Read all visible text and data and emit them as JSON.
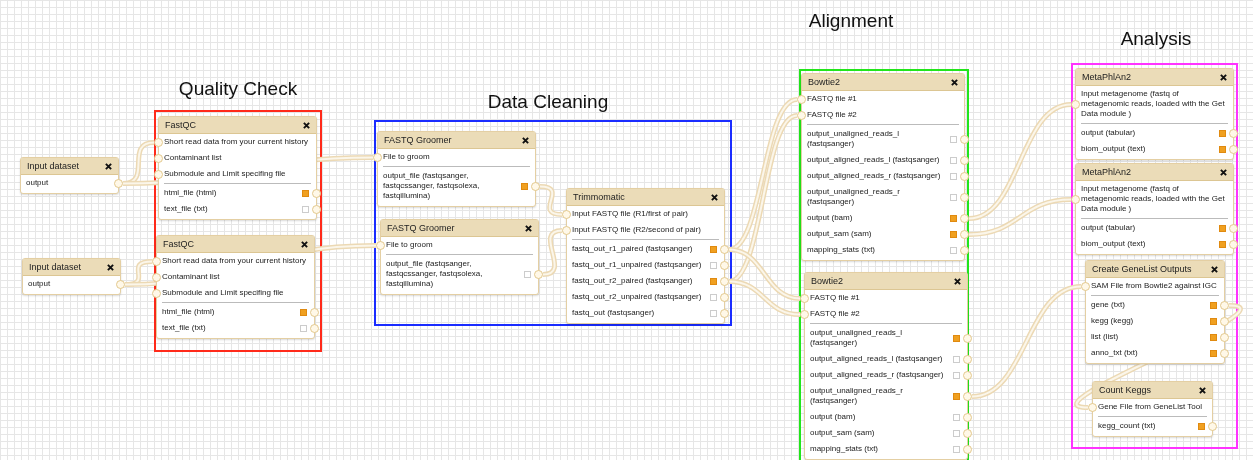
{
  "inputs": [
    {
      "title": "Input dataset",
      "outputs": [
        "output"
      ]
    },
    {
      "title": "Input dataset",
      "outputs": [
        "output"
      ]
    }
  ],
  "groups": [
    {
      "title": "Quality Check",
      "color": "#ff2a1a",
      "nodes": [
        {
          "title": "FastQC",
          "inputs": [
            "Short read data from your current history",
            "Contaminant list",
            "Submodule and Limit specifing file"
          ],
          "outputs": [
            {
              "label": "html_file (html)",
              "checked": true
            },
            {
              "label": "text_file (txt)",
              "checked": false
            }
          ]
        },
        {
          "title": "FastQC",
          "inputs": [
            "Short read data from your current history",
            "Contaminant list",
            "Submodule and Limit specifing file"
          ],
          "outputs": [
            {
              "label": "html_file (html)",
              "checked": true
            },
            {
              "label": "text_file (txt)",
              "checked": false
            }
          ]
        }
      ]
    },
    {
      "title": "Data Cleaning",
      "color": "#1a2cff",
      "nodes": [
        {
          "title": "FASTQ Groomer",
          "inputs": [
            "File to groom"
          ],
          "outputs": [
            {
              "label": "output_file (fastqsanger, fastqcssanger, fastqsolexa, fastqillumina)",
              "checked": true
            }
          ]
        },
        {
          "title": "FASTQ Groomer",
          "inputs": [
            "File to groom"
          ],
          "outputs": [
            {
              "label": "output_file (fastqsanger, fastqcssanger, fastqsolexa, fastqillumina)",
              "checked": false
            }
          ]
        },
        {
          "title": "Trimmomatic",
          "inputs": [
            "Input FASTQ file (R1/first of pair)",
            "Input FASTQ file (R2/second of pair)"
          ],
          "outputs": [
            {
              "label": "fastq_out_r1_paired (fastqsanger)",
              "checked": true
            },
            {
              "label": "fastq_out_r1_unpaired (fastqsanger)",
              "checked": false
            },
            {
              "label": "fastq_out_r2_paired (fastqsanger)",
              "checked": true
            },
            {
              "label": "fastq_out_r2_unpaired (fastqsanger)",
              "checked": false
            },
            {
              "label": "fastq_out (fastqsanger)",
              "checked": false
            }
          ]
        }
      ]
    },
    {
      "title": "Alignment",
      "color": "#22e51a",
      "nodes": [
        {
          "title": "Bowtie2",
          "inputs": [
            "FASTQ file #1",
            "FASTQ file #2"
          ],
          "outputs": [
            {
              "label": "output_unaligned_reads_l (fastqsanger)",
              "checked": false
            },
            {
              "label": "output_aligned_reads_l (fastqsanger)",
              "checked": false
            },
            {
              "label": "output_aligned_reads_r (fastqsanger)",
              "checked": false
            },
            {
              "label": "output_unaligned_reads_r (fastqsanger)",
              "checked": false
            },
            {
              "label": "output (bam)",
              "checked": true
            },
            {
              "label": "output_sam (sam)",
              "checked": true
            },
            {
              "label": "mapping_stats (txt)",
              "checked": false
            }
          ]
        },
        {
          "title": "Bowtie2",
          "inputs": [
            "FASTQ file #1",
            "FASTQ file #2"
          ],
          "outputs": [
            {
              "label": "output_unaligned_reads_l (fastqsanger)",
              "checked": true
            },
            {
              "label": "output_aligned_reads_l (fastqsanger)",
              "checked": false
            },
            {
              "label": "output_aligned_reads_r (fastqsanger)",
              "checked": false
            },
            {
              "label": "output_unaligned_reads_r (fastqsanger)",
              "checked": true
            },
            {
              "label": "output (bam)",
              "checked": false
            },
            {
              "label": "output_sam (sam)",
              "checked": false
            },
            {
              "label": "mapping_stats (txt)",
              "checked": false
            }
          ]
        }
      ]
    },
    {
      "title": "Analysis",
      "color": "#ff33ff",
      "nodes": [
        {
          "title": "MetaPhlAn2",
          "inputs": [
            "Input metagenome (fastq of metagenomic reads, loaded with the Get Data module )"
          ],
          "outputs": [
            {
              "label": "output (tabular)",
              "checked": true
            },
            {
              "label": "biom_output (text)",
              "checked": true
            }
          ]
        },
        {
          "title": "MetaPhlAn2",
          "inputs": [
            "Input metagenome (fastq of metagenomic reads, loaded with the Get Data module )"
          ],
          "outputs": [
            {
              "label": "output (tabular)",
              "checked": true
            },
            {
              "label": "biom_output (text)",
              "checked": true
            }
          ]
        },
        {
          "title": "Create GeneList Outputs",
          "inputs": [
            "SAM File from Bowtie2 against IGC"
          ],
          "outputs": [
            {
              "label": "gene (txt)",
              "checked": true
            },
            {
              "label": "kegg (kegg)",
              "checked": true
            },
            {
              "label": "list (list)",
              "checked": true
            },
            {
              "label": "anno_txt (txt)",
              "checked": true
            }
          ]
        },
        {
          "title": "Count Keggs",
          "inputs": [
            "Gene File from GeneList Tool"
          ],
          "outputs": [
            {
              "label": "kegg_count (txt)",
              "checked": true
            }
          ]
        }
      ]
    }
  ]
}
